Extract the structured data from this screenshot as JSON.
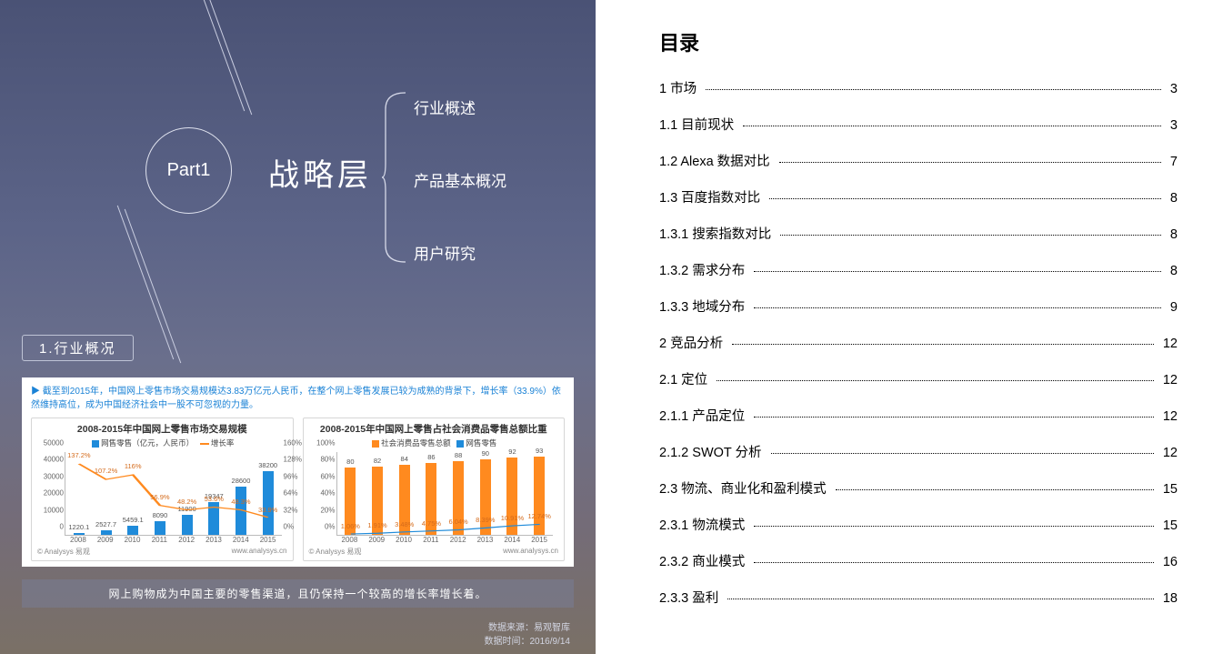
{
  "left": {
    "part_label": "Part1",
    "main_label": "战略层",
    "sub_items": [
      "行业概述",
      "产品基本概况",
      "用户研究"
    ],
    "section_header": "1.行业概况",
    "chart_intro": "截至到2015年，中国网上零售市场交易规模达3.83万亿元人民币，在整个网上零售发展已较为成熟的背景下，增长率（33.9%）依然维持高位，成为中国经济社会中一股不可忽视的力量。",
    "caption": "网上购物成为中国主要的零售渠道，且仍保持一个较高的增长率增长着。",
    "source_label": "数据来源：易观智库",
    "source_date_label": "数据时间：",
    "source_date": "2016/9/14",
    "chart1_title": "2008-2015年中国网上零售市场交易规模",
    "chart1_legend_bar": "网售零售（亿元，人民币）",
    "chart1_legend_line": "增长率",
    "chart2_title": "2008-2015年中国网上零售占社会消费品零售总额比重",
    "chart2_legend_bar": "社会消费品零售总额",
    "chart2_legend_line": "网售零售",
    "chart_footer_left": "© Analysys 易观",
    "chart_footer_right": "www.analysys.cn"
  },
  "toc": {
    "title": "目录",
    "items": [
      {
        "label": "1  市场",
        "page": "3"
      },
      {
        "label": "1.1  目前现状",
        "page": "3"
      },
      {
        "label": "1.2 Alexa  数据对比",
        "page": "7"
      },
      {
        "label": "1.3  百度指数对比",
        "page": "8"
      },
      {
        "label": "1.3.1  搜索指数对比",
        "page": "8"
      },
      {
        "label": "1.3.2  需求分布",
        "page": "8"
      },
      {
        "label": "1.3.3  地域分布",
        "page": "9"
      },
      {
        "label": "2  竞品分析",
        "page": "12"
      },
      {
        "label": "2.1  定位",
        "page": "12"
      },
      {
        "label": "2.1.1  产品定位",
        "page": "12"
      },
      {
        "label": "2.1.2 SWOT 分析",
        "page": "12"
      },
      {
        "label": "2.3  物流、商业化和盈利模式",
        "page": "15"
      },
      {
        "label": "2.3.1  物流模式",
        "page": "15"
      },
      {
        "label": "2.3.2  商业模式",
        "page": "16"
      },
      {
        "label": "2.3.3  盈利",
        "page": "18"
      }
    ]
  },
  "chart_data": [
    {
      "type": "bar+line",
      "title": "2008-2015年中国网上零售市场交易规模",
      "categories": [
        "2008",
        "2009",
        "2010",
        "2011",
        "2012",
        "2013",
        "2014",
        "2015"
      ],
      "series": [
        {
          "name": "网售零售（亿元，人民币）",
          "type": "bar",
          "values": [
            1220.1,
            2527.7,
            5459.1,
            8090,
            11900,
            19346.8,
            28600,
            38200
          ]
        },
        {
          "name": "增长率",
          "type": "line",
          "values": [
            137.2,
            107.2,
            116.0,
            56.9,
            48.2,
            53.6,
            48.3,
            33.9
          ]
        }
      ],
      "ylabel_left": "亿元",
      "ylim_left": [
        0,
        50000
      ],
      "ylabel_right": "%",
      "ylim_right": [
        0,
        160
      ]
    },
    {
      "type": "bar+line",
      "title": "2008-2015年中国网上零售占社会消费品零售总额比重",
      "categories": [
        "2008",
        "2009",
        "2010",
        "2011",
        "2012",
        "2013",
        "2014",
        "2015"
      ],
      "series": [
        {
          "name": "社会消费品零售总额",
          "type": "bar",
          "values": [
            80,
            82,
            84,
            86,
            88,
            90,
            92,
            93
          ]
        },
        {
          "name": "网售零售",
          "type": "line",
          "values": [
            1.06,
            1.91,
            3.48,
            4.75,
            6.04,
            8.39,
            10.91,
            12.74
          ]
        }
      ],
      "ylabel_left": "%",
      "ylim_left": [
        0,
        100
      ]
    }
  ]
}
